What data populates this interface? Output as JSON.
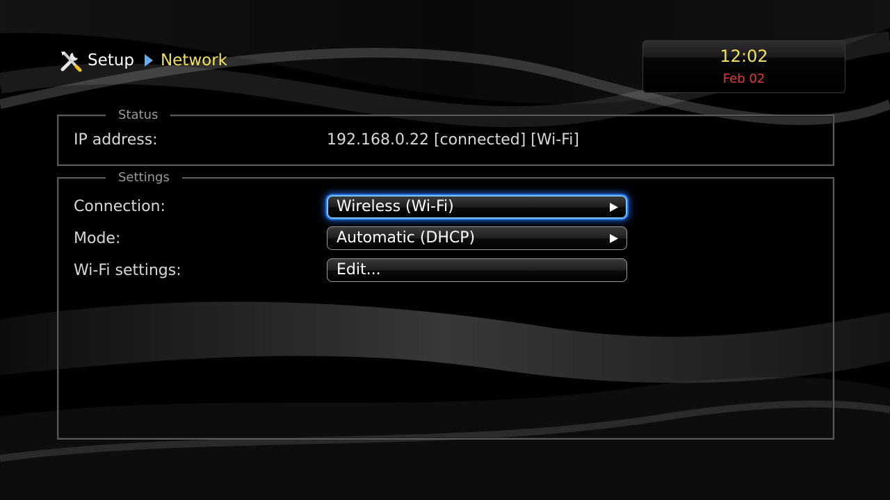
{
  "header": {
    "icon": "tools-icon",
    "breadcrumb_root": "Setup",
    "breadcrumb_separator_icon": "triangle-right-icon",
    "breadcrumb_current": "Network"
  },
  "clock": {
    "time": "12:02",
    "date": "Feb 02"
  },
  "status": {
    "legend": "Status",
    "ip_label": "IP address:",
    "ip_value": "192.168.0.22 [connected] [Wi-Fi]"
  },
  "settings": {
    "legend": "Settings",
    "connection_label": "Connection:",
    "connection_value": "Wireless (Wi-Fi)",
    "mode_label": "Mode:",
    "mode_value": "Automatic (DHCP)",
    "wifi_label": "Wi-Fi settings:",
    "wifi_value": "Edit..."
  },
  "colors": {
    "accent_yellow": "#f2e35a",
    "date_red": "#e03a3a",
    "focus_blue": "#1f6fe0"
  }
}
